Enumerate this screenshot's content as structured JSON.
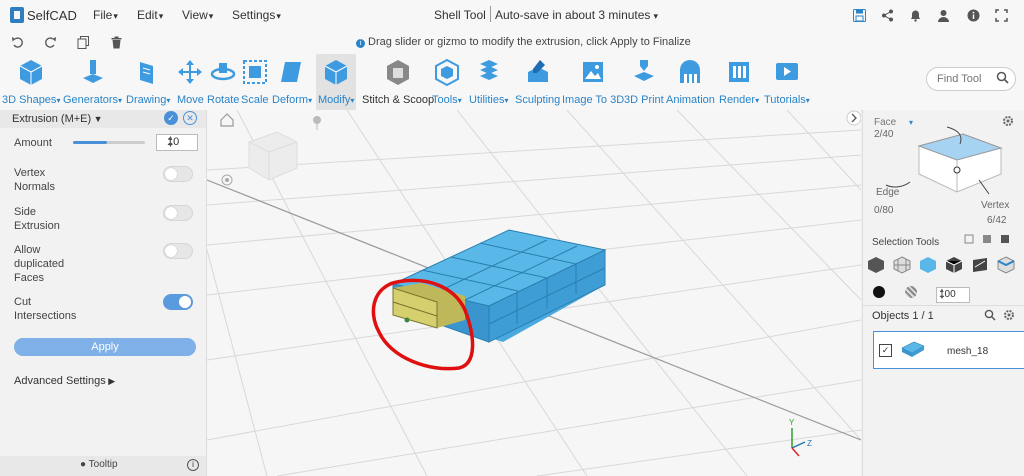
{
  "app": {
    "name": "SelfCAD"
  },
  "menu": [
    {
      "label": "File"
    },
    {
      "label": "Edit"
    },
    {
      "label": "View"
    },
    {
      "label": "Settings"
    }
  ],
  "document": {
    "title": "Shell Tool",
    "autosave": "Auto-save in about 3 minutes"
  },
  "hint": "Drag slider or gizmo to modify the extrusion, click Apply to Finalize",
  "toolbar": [
    {
      "label": "3D Shapes"
    },
    {
      "label": "Generators"
    },
    {
      "label": "Drawing"
    },
    {
      "label": "Move"
    },
    {
      "label": "Rotate"
    },
    {
      "label": "Scale"
    },
    {
      "label": "Deform"
    },
    {
      "label": "Modify"
    },
    {
      "label": "Stitch & Scoop"
    },
    {
      "label": "Tools"
    },
    {
      "label": "Utilities"
    },
    {
      "label": "Sculpting"
    },
    {
      "label": "Image To 3D"
    },
    {
      "label": "3D Print"
    },
    {
      "label": "Animation"
    },
    {
      "label": "Render"
    },
    {
      "label": "Tutorials"
    }
  ],
  "find_tool": {
    "placeholder": "Find Tool"
  },
  "extrusion_panel": {
    "title": "Extrusion (M+E)",
    "amount_label": "Amount",
    "amount_value": "10",
    "amount_fraction": 0.47,
    "vertex_normals_label": "Vertex\nNormals",
    "vertex_normals_on": false,
    "side_extrusion_label": "Side\nExtrusion",
    "side_extrusion_on": false,
    "allow_dup_label": "Allow\nduplicated\nFaces",
    "allow_dup_on": false,
    "cut_intersections_label": "Cut\nIntersections",
    "cut_intersections_on": true,
    "apply_label": "Apply",
    "advanced_label": "Advanced Settings",
    "tooltip_label": "Tooltip"
  },
  "right_panel": {
    "face_label": "Face",
    "face_count": "2/40",
    "edge_label": "Edge",
    "edge_count": "0/80",
    "vertex_label": "Vertex",
    "vertex_count": "6/42",
    "selection_tools_label": "Selection Tools",
    "brush_size": "100",
    "objects_label": "Objects 1 / 1",
    "object_name": "mesh_18"
  },
  "colors": {
    "accent": "#2a84c8",
    "mesh": "#5ab8e8",
    "selected_face": "#c8c26a",
    "annotation": "#e01010"
  }
}
